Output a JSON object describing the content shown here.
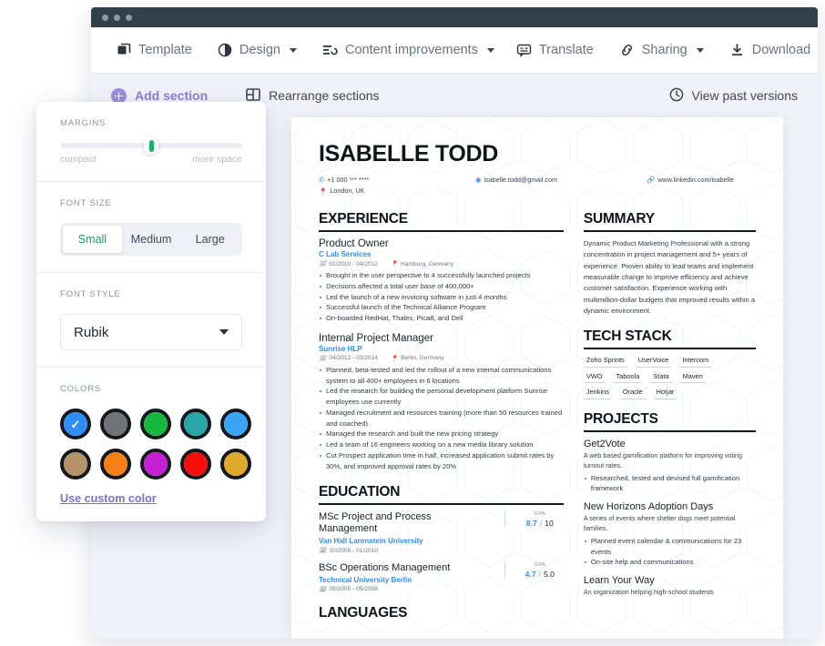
{
  "window": {
    "toolbar": [
      {
        "id": "template",
        "label": "Template",
        "icon": "copy-icon",
        "caret": false
      },
      {
        "id": "design",
        "label": "Design",
        "icon": "contrast-icon",
        "caret": true
      },
      {
        "id": "content-improvements",
        "label": "Content improvements",
        "icon": "list-check-icon",
        "caret": true
      },
      {
        "id": "translate",
        "label": "Translate",
        "icon": "translate-bubble-icon",
        "caret": false
      },
      {
        "id": "sharing",
        "label": "Sharing",
        "icon": "link-icon",
        "caret": true
      },
      {
        "id": "download",
        "label": "Download",
        "icon": "download-icon",
        "caret": false
      }
    ]
  },
  "subbar": {
    "add_section": "Add section",
    "rearrange_sections": "Rearrange sections",
    "view_past_versions": "View past versions"
  },
  "panel": {
    "margins": {
      "label": "MARGINS",
      "left_end": "compact",
      "right_end": "more space",
      "value_percent": 50,
      "knob_color": "#13b26a"
    },
    "font_size": {
      "label": "FONT SIZE",
      "options": [
        "Small",
        "Medium",
        "Large"
      ],
      "selected": "Small",
      "active_color": "#18a463"
    },
    "font_style": {
      "label": "FONT STYLE",
      "selected": "Rubik"
    },
    "colors": {
      "label": "COLORS",
      "selected_index": 0,
      "swatches": [
        {
          "name": "blue",
          "hex": "#2f8ef4"
        },
        {
          "name": "grey",
          "hex": "#6f7479"
        },
        {
          "name": "green",
          "hex": "#17ba3e"
        },
        {
          "name": "teal",
          "hex": "#2aa6a8"
        },
        {
          "name": "bright-blue",
          "hex": "#3aa5f5"
        },
        {
          "name": "tan",
          "hex": "#b59268"
        },
        {
          "name": "orange",
          "hex": "#f77f18"
        },
        {
          "name": "magenta",
          "hex": "#c620d4"
        },
        {
          "name": "red",
          "hex": "#f70d0d"
        },
        {
          "name": "gold",
          "hex": "#e0a92e"
        }
      ],
      "custom_link": "Use custom color"
    }
  },
  "resume": {
    "name": "ISABELLE TODD",
    "contacts": [
      {
        "icon": "phone-icon",
        "text": "+1 000 *** ****"
      },
      {
        "icon": "email-icon",
        "text": "isabelle.todd@gmail.com"
      },
      {
        "icon": "link-icon",
        "text": "www.linkedin.com/isabelle"
      },
      {
        "icon": "location-icon",
        "text": "London, UK"
      }
    ],
    "experience": {
      "heading": "EXPERIENCE",
      "jobs": [
        {
          "title": "Product Owner",
          "org": "C Lab Services",
          "dates": "02/2010 - 04/2012",
          "location": "Hamburg, Germany",
          "bullets": [
            "Brought in the user perspective to 4 successfully launched projects",
            "Decisions affected a total user base of 400,000+",
            "Led the launch of a new invoicing software in just 4 months",
            "Successful launch of the Technical Alliance Program",
            "On-boarded RedHat, Thales, Pica8, and Dell"
          ]
        },
        {
          "title": "Internal Project Manager",
          "org": "Sunrise HLP",
          "dates": "04/2012 - 03/2014",
          "location": "Berlin, Germany",
          "bullets": [
            "Planned, beta-tested and led the rollout of a new internal communications system to all 400+ employees in 6 locations",
            "Led the research for building the personal development platform Sunrise employees use currently",
            "Managed recruitment and resources training (more than 50 resources trained and coached)",
            "Managed the research and built the new pricing strategy",
            "Led a team of 16 engineers working on a new media library solution",
            "Cut Prospect application time in half, increased application submit rates by 30%, and improved approval rates by 20%"
          ]
        }
      ]
    },
    "education": {
      "heading": "EDUCATION",
      "entries": [
        {
          "title": "MSc Project and Process Management",
          "org": "Van Hall Larenstein University",
          "dates": "10/2008 - 01/2010",
          "gpa_label": "GPA",
          "gpa_value": "8.7",
          "gpa_max": "10"
        },
        {
          "title": "BSc Operations Management",
          "org": "Technical University Berlin",
          "dates": "09/2005 - 05/2008",
          "gpa_label": "GPA",
          "gpa_value": "4.7",
          "gpa_max": "5.0"
        }
      ]
    },
    "languages": {
      "heading": "LANGUAGES"
    },
    "summary": {
      "heading": "SUMMARY",
      "text": "Dynamic Product Marketing Professional with a strong concentration in project management and 5+ years of experience. Proven ability to lead teams and implement measurable change to improve efficiency and achieve customer satisfaction. Experience working with multimillion-dollar budgets that improved results within a dynamic environment."
    },
    "tech_stack": {
      "heading": "TECH STACK",
      "rows": [
        [
          "Zoho Sprints",
          "UserVoice",
          "Intercom"
        ],
        [
          "VWO",
          "Taboola",
          "Stata",
          "Maven"
        ],
        [
          "Jenkins",
          "Oracle",
          "Hotjar"
        ]
      ]
    },
    "projects": {
      "heading": "PROJECTS",
      "items": [
        {
          "title": "Get2Vote",
          "desc": "A web based gamification platform for improving voting turnout rates.",
          "bullets": [
            "Researched, tested and devised full gamification framework"
          ]
        },
        {
          "title": "New Horizons Adoption Days",
          "desc": "A series of events where shelter dogs meet potential families.",
          "bullets": [
            "Planned event calendar & communications for 23 events",
            "On-site help and communications"
          ]
        },
        {
          "title": "Learn Your Way",
          "desc": "An organization helping high-school students",
          "bullets": []
        }
      ]
    }
  }
}
